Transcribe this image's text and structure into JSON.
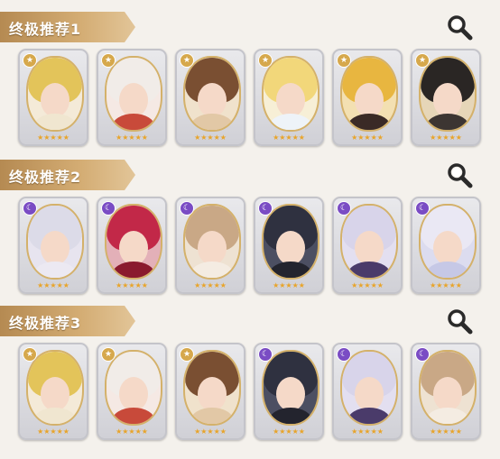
{
  "sections": [
    {
      "title": "终极推荐1",
      "cards": [
        {
          "name": "blonde-hero",
          "badge": "gold",
          "hair": "#e3c45a",
          "body": "#f0e6d0",
          "bg": "#f4ead8",
          "stars": "★★★★★"
        },
        {
          "name": "white-red-hat",
          "badge": "gold",
          "hair": "#f1ece8",
          "body": "#c84a3a",
          "bg": "#f5e9e4",
          "stars": "★★★★★"
        },
        {
          "name": "brown-hair",
          "badge": "gold",
          "hair": "#7a4f32",
          "body": "#e2c8a6",
          "bg": "#f0e2cc",
          "stars": "★★★★★"
        },
        {
          "name": "blonde-white-hat",
          "badge": "gold",
          "hair": "#f2d77a",
          "body": "#eef3f8",
          "bg": "#f7efd6",
          "stars": "★★★★★"
        },
        {
          "name": "gold-ornate",
          "badge": "gold",
          "hair": "#e8b640",
          "body": "#3a2a26",
          "bg": "#f3e0b2",
          "stars": "★★★★★"
        },
        {
          "name": "dark-hair-man",
          "badge": "gold",
          "hair": "#2a2624",
          "body": "#3c3532",
          "bg": "#e6d6b8",
          "stars": "★★★★★"
        }
      ]
    },
    {
      "title": "终极推荐2",
      "cards": [
        {
          "name": "silver-maid",
          "badge": "purple",
          "hair": "#dcdbe8",
          "body": "#ece9f2",
          "bg": "#e7e4ef",
          "stars": "★★★★★"
        },
        {
          "name": "red-hair",
          "badge": "purple",
          "hair": "#c22848",
          "body": "#8a1a2e",
          "bg": "#e3b0b8",
          "stars": "★★★★★"
        },
        {
          "name": "light-brown-maid",
          "badge": "purple",
          "hair": "#c9a886",
          "body": "#f4ece2",
          "bg": "#eee2d2",
          "stars": "★★★★★"
        },
        {
          "name": "dark-knight",
          "badge": "purple",
          "hair": "#2f3140",
          "body": "#23242e",
          "bg": "#4c4f62",
          "stars": "★★★★★"
        },
        {
          "name": "lavender-hair",
          "badge": "purple",
          "hair": "#d8d4ea",
          "body": "#4a3b6a",
          "bg": "#e3dff0",
          "stars": "★★★★★"
        },
        {
          "name": "white-bonnet",
          "badge": "purple",
          "hair": "#eae8f4",
          "body": "#c6c8e6",
          "bg": "#dcdcef",
          "stars": "★★★★★"
        }
      ]
    },
    {
      "title": "终极推荐3",
      "cards": [
        {
          "name": "blonde-hero",
          "badge": "gold",
          "hair": "#e3c45a",
          "body": "#f0e6d0",
          "bg": "#f4ead8",
          "stars": "★★★★★"
        },
        {
          "name": "white-red-hat",
          "badge": "gold",
          "hair": "#f1ece8",
          "body": "#c84a3a",
          "bg": "#f5e9e4",
          "stars": "★★★★★"
        },
        {
          "name": "brown-hair",
          "badge": "gold",
          "hair": "#7a4f32",
          "body": "#e2c8a6",
          "bg": "#f0e2cc",
          "stars": "★★★★★"
        },
        {
          "name": "dark-knight",
          "badge": "purple",
          "hair": "#2f3140",
          "body": "#23242e",
          "bg": "#4c4f62",
          "stars": "★★★★★"
        },
        {
          "name": "lavender-hair",
          "badge": "purple",
          "hair": "#d8d4ea",
          "body": "#4a3b6a",
          "bg": "#e3dff0",
          "stars": "★★★★★"
        },
        {
          "name": "light-brown-maid",
          "badge": "purple",
          "hair": "#c9a886",
          "body": "#f4ece2",
          "bg": "#eee2d2",
          "stars": "★★★★★"
        }
      ]
    }
  ]
}
